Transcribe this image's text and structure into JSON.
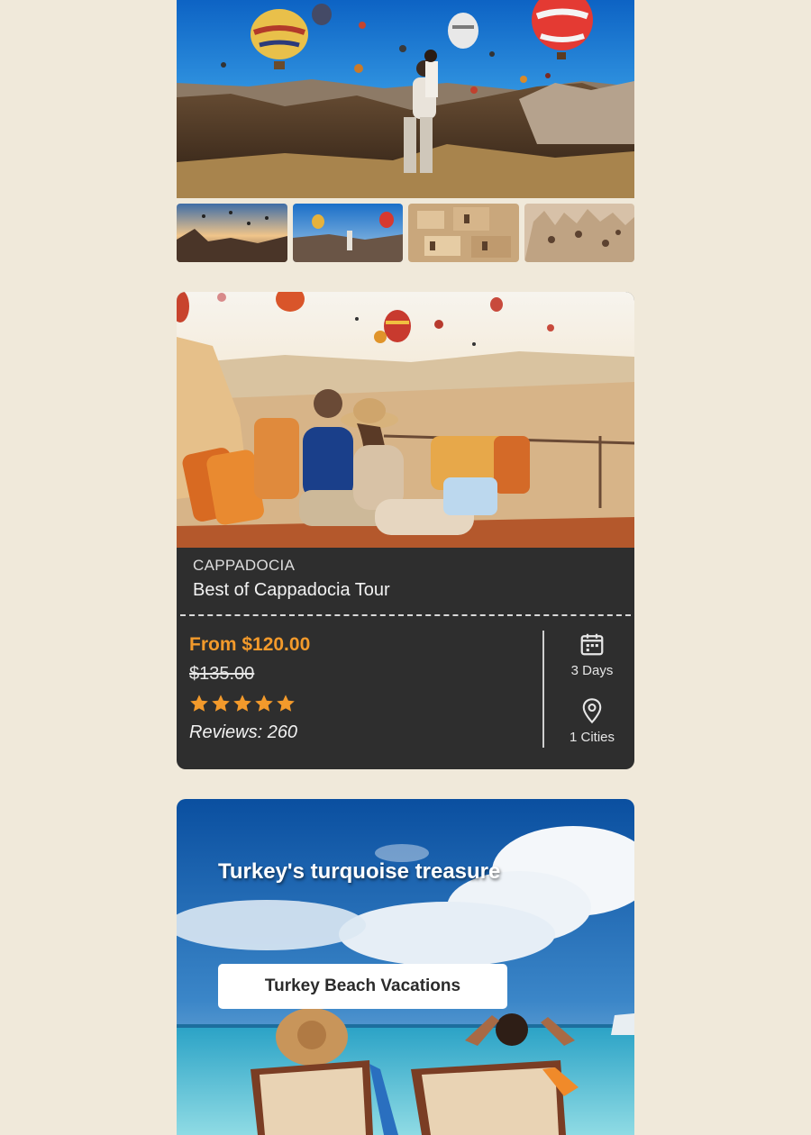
{
  "gallery": {
    "hero_alt": "Couple among hot air balloons over Cappadocia valley",
    "thumbnails": [
      {
        "alt": "Balloons at sunrise over valley"
      },
      {
        "alt": "Couple with balloons"
      },
      {
        "alt": "Cave hotel houses"
      },
      {
        "alt": "Rock formations with cave dwellings"
      }
    ]
  },
  "tour_card": {
    "region": "CAPPADOCIA",
    "title": "Best of Cappadocia Tour",
    "price_from": "From $120.00",
    "price_old": "$135.00",
    "rating_stars": 5,
    "reviews": "Reviews: 260",
    "days": "3 Days",
    "cities": "1 Cities",
    "accent_color": "#f39a2b",
    "icons": [
      "calendar-icon",
      "map-pin-icon",
      "star-icon"
    ]
  },
  "beach_promo": {
    "headline": "Turkey's turquoise treasure",
    "button_label": "Turkey Beach Vacations"
  }
}
